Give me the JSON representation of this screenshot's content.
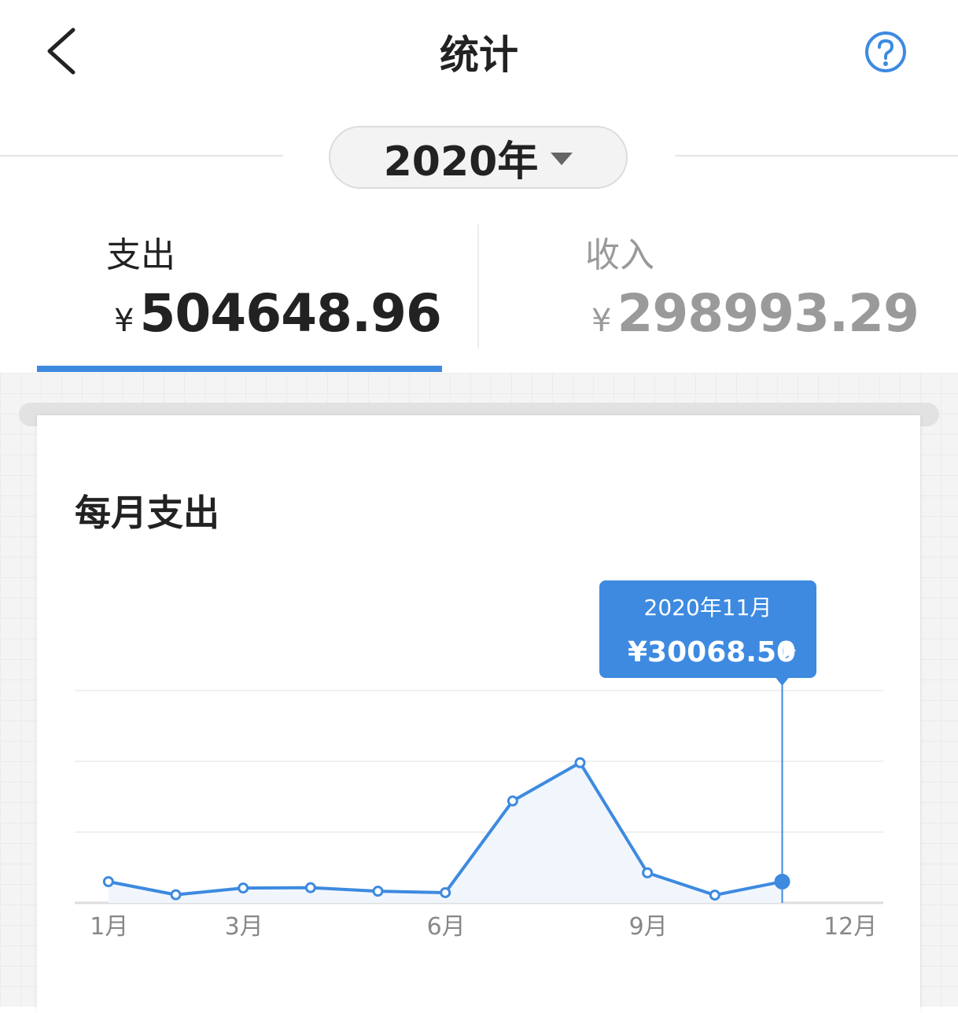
{
  "nav": {
    "title": "统计"
  },
  "year_selector": {
    "label": "2020年"
  },
  "tabs": {
    "expense": {
      "label": "支出",
      "currency": "¥",
      "amount": "504648.96"
    },
    "income": {
      "label": "收入",
      "currency": "¥",
      "amount": "298993.29"
    }
  },
  "card": {
    "title": "每月支出"
  },
  "tooltip": {
    "period": "2020年11月",
    "amount": "¥30068.50"
  },
  "colors": {
    "accent": "#3d8ae0",
    "fill": "#f1f6fd",
    "axis_text": "#888888",
    "grid": "#ececec"
  },
  "chart_data": {
    "type": "area",
    "title": "每月支出",
    "x": [
      1,
      2,
      3,
      4,
      5,
      6,
      7,
      8,
      9,
      10,
      11
    ],
    "x_ticks": [
      {
        "x": 1,
        "label": "1月"
      },
      {
        "x": 3,
        "label": "3月"
      },
      {
        "x": 6,
        "label": "6月"
      },
      {
        "x": 9,
        "label": "9月"
      },
      {
        "x": 12,
        "label": "12月"
      }
    ],
    "series": [
      {
        "values": [
          30000,
          11500,
          21000,
          21500,
          16500,
          14500,
          144000,
          198000,
          42500,
          11000,
          30068.5
        ]
      }
    ],
    "xlim": [
      0.5,
      12.5
    ],
    "ylim": [
      0,
      300000
    ],
    "gridlines": [
      0,
      100000,
      200000,
      300000
    ],
    "highlight_index": 10,
    "grid": true,
    "legend": "none"
  }
}
